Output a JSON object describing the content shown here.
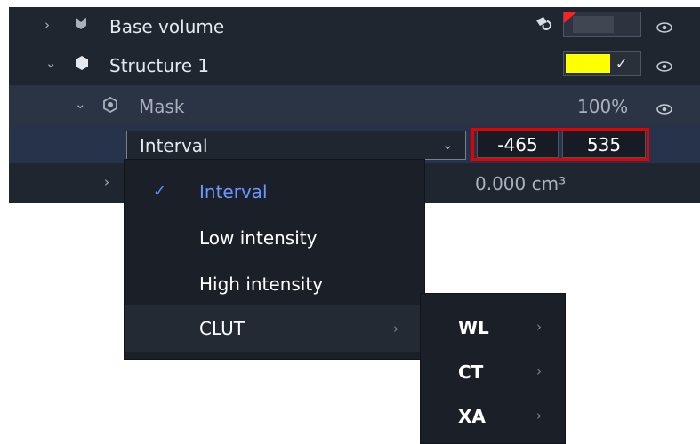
{
  "layers": {
    "base_volume": {
      "label": "Base volume",
      "expand_icon": "chevron-right-icon",
      "type_icon": "cube-stack-icon",
      "tool_icon": "paint-drop-icon",
      "visibility_icon": "eye-icon"
    },
    "structure": {
      "label": "Structure 1",
      "expand_icon": "chevron-down-icon",
      "type_icon": "hexagon-icon",
      "color": "#ffff00",
      "visibility_icon": "eye-icon"
    },
    "mask": {
      "label": "Mask",
      "percent": "100%",
      "type_icon": "mask-icon",
      "visibility_icon": "eye-icon"
    },
    "interval": {
      "selected": "Interval",
      "low": "-465",
      "high": "535"
    },
    "volume": {
      "value": "0.000 cm³"
    }
  },
  "dropdown": {
    "items": [
      {
        "label": "Interval",
        "checked": true
      },
      {
        "label": "Low intensity",
        "checked": false
      },
      {
        "label": "High intensity",
        "checked": false
      },
      {
        "label": "CLUT",
        "checked": false,
        "has_submenu": true
      }
    ]
  },
  "submenu": {
    "items": [
      {
        "label": "WL"
      },
      {
        "label": "CT"
      },
      {
        "label": "XA"
      }
    ]
  },
  "colors": {
    "panel": "#1f2630",
    "row_selected": "#27334b",
    "accent_check": "#5b8cff",
    "highlight": "#e60000",
    "structure_color": "#ffff00"
  }
}
